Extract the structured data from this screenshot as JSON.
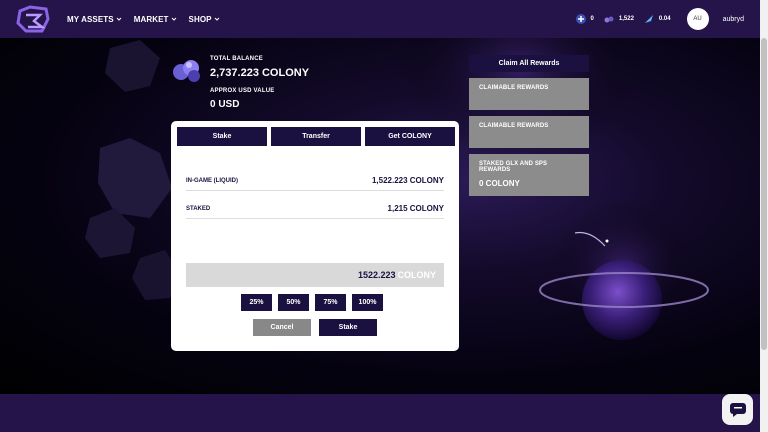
{
  "nav": {
    "items": [
      {
        "label": "MY ASSETS"
      },
      {
        "label": "MARKET"
      },
      {
        "label": "SHOP"
      }
    ]
  },
  "stats": {
    "s1": "0",
    "s2": "1,522",
    "s3": "0.04"
  },
  "user": {
    "initials": "AU",
    "name": "aubryd"
  },
  "balance": {
    "total_label": "TOTAL BALANCE",
    "total_value": "2,737.223 COLONY",
    "usd_label": "APPROX USD VALUE",
    "usd_value": "0 USD"
  },
  "modal": {
    "tabs": [
      "Stake",
      "Transfer",
      "Get COLONY"
    ],
    "rows": [
      {
        "label": "IN-GAME (LIQUID)",
        "value": "1,522.223 COLONY"
      },
      {
        "label": "STAKED",
        "value": "1,215 COLONY"
      }
    ],
    "amount": "1522.223",
    "amount_unit": "COLONY",
    "percents": [
      "25%",
      "50%",
      "75%",
      "100%"
    ],
    "cancel": "Cancel",
    "confirm": "Stake"
  },
  "rewards": {
    "claim_all": "Claim All Rewards",
    "cards": [
      {
        "title": "CLAIMABLE REWARDS",
        "value": ""
      },
      {
        "title": "CLAIMABLE REWARDS",
        "value": ""
      },
      {
        "title": "STAKED GLX AND SPS REWARDS",
        "value": "0 COLONY"
      }
    ]
  },
  "colors": {
    "header_bg": "#24144a",
    "accent": "#1b1140",
    "card_bg": "#8c8c8c"
  },
  "icons": [
    "logo-icon",
    "chevron-down-icon",
    "glx-icon",
    "colony-icon",
    "sps-icon",
    "chat-icon"
  ]
}
